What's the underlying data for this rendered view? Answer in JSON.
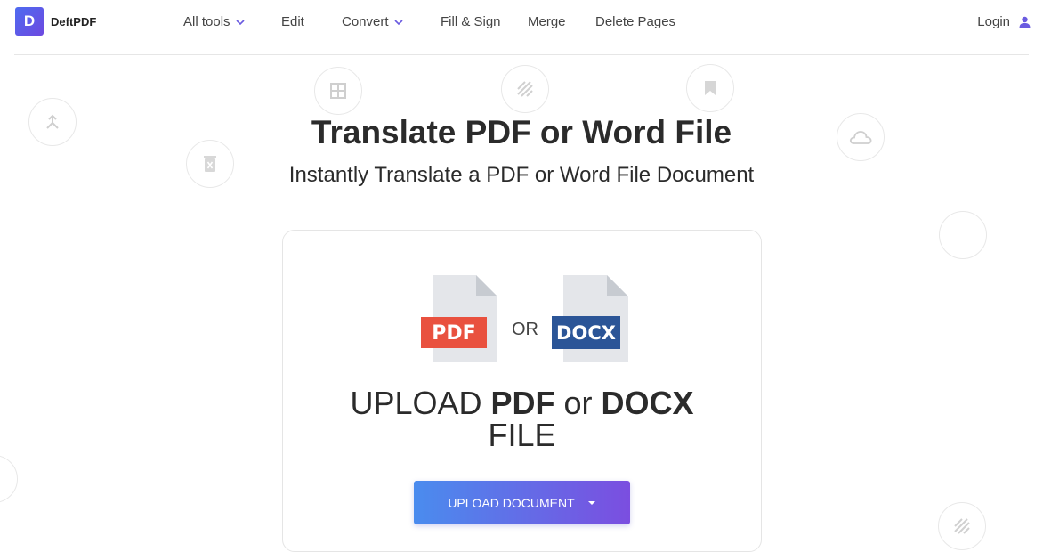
{
  "brand": {
    "logo_letter": "D",
    "name": "DeftPDF"
  },
  "nav": {
    "items": [
      {
        "label": "All tools",
        "has_dropdown": true
      },
      {
        "label": "Edit",
        "has_dropdown": false
      },
      {
        "label": "Convert",
        "has_dropdown": true
      },
      {
        "label": "Fill & Sign",
        "has_dropdown": false
      },
      {
        "label": "Merge",
        "has_dropdown": false
      },
      {
        "label": "Delete Pages",
        "has_dropdown": false
      }
    ],
    "login_label": "Login"
  },
  "hero": {
    "title": "Translate PDF or Word File",
    "subtitle": "Instantly Translate a PDF or Word File Document"
  },
  "upload": {
    "pdf_badge": "PDF",
    "or_label": "OR",
    "docx_badge": "DOCX",
    "heading_prefix": "UPLOAD ",
    "heading_pdf": "PDF",
    "heading_or": " or ",
    "heading_docx": "DOCX",
    "heading_suffix": "FILE",
    "button_label": "UPLOAD DOCUMENT"
  },
  "colors": {
    "accent": "#6a5be0",
    "pdf_red": "#e9513f",
    "docx_blue": "#2b5597",
    "file_gray": "#e4e6ea"
  },
  "decorative_icons": [
    "merge-icon",
    "delete-icon",
    "grid-icon",
    "hatch-icon",
    "bookmark-icon",
    "cloud-icon"
  ]
}
